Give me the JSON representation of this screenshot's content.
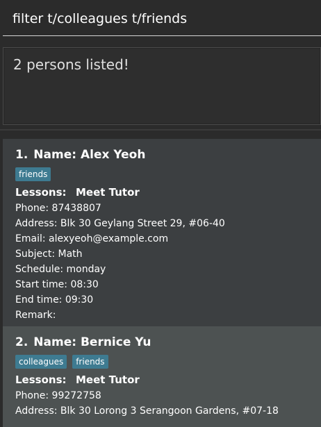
{
  "command_box": {
    "value": "filter t/colleagues t/friends"
  },
  "result_display": {
    "text": "2 persons listed!"
  },
  "persons": [
    {
      "index": "1.",
      "name": "Name: Alex Yeoh",
      "tags": [
        "friends"
      ],
      "lessons_label": "Lessons:",
      "lessons_value": "Meet Tutor",
      "phone": "Phone: 87438807",
      "address": "Address: Blk 30 Geylang Street 29, #06-40",
      "email": "Email: alexyeoh@example.com",
      "subject": "Subject: Math",
      "schedule": "Schedule: monday",
      "start_time": "Start time: 08:30",
      "end_time": "End time: 09:30",
      "remark": "Remark:"
    },
    {
      "index": "2.",
      "name": "Name: Bernice Yu",
      "tags": [
        "colleagues",
        "friends"
      ],
      "lessons_label": "Lessons:",
      "lessons_value": "Meet Tutor",
      "phone": "Phone: 99272758",
      "address": "Address: Blk 30 Lorong 3 Serangoon Gardens, #07-18"
    }
  ],
  "colors": {
    "background": "#2b2b2b",
    "card_odd": "#3c3f41",
    "card_even": "#4d5252",
    "tag": "#3e7b91"
  }
}
